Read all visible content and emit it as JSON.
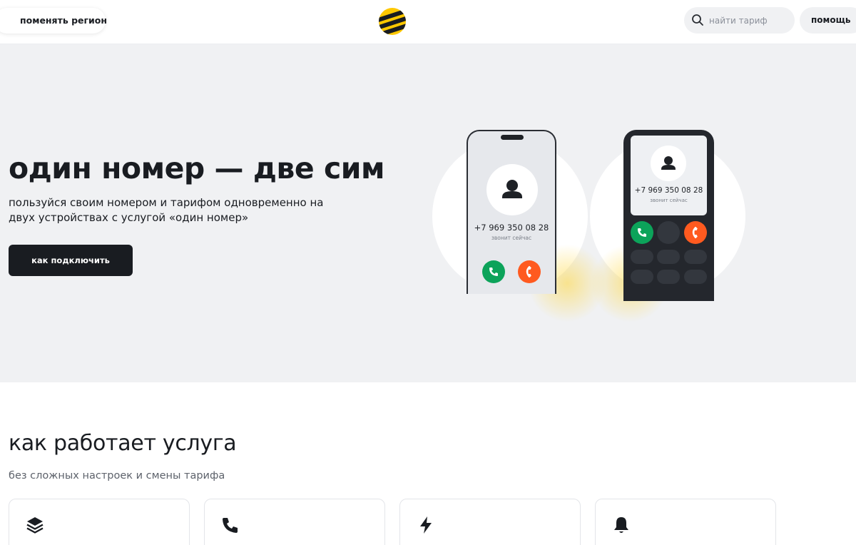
{
  "header": {
    "region_label": "поменять регион",
    "search_placeholder": "найти тариф",
    "help_label": "помощь"
  },
  "hero": {
    "title": "один номер — две сим",
    "subtitle": "пользуйся своим номером и тарифом одновременно на двух устройствах с услугой «один номер»",
    "button_label": "как подключить",
    "phone_a": {
      "number": "+7 969 350 08 28",
      "status": "звонит сейчас"
    },
    "phone_b": {
      "number": "+7 969 350 08 28",
      "status": "звонит сейчас"
    }
  },
  "section": {
    "title": "как работает услуга",
    "subtitle": "без сложных настроек и смены тарифа",
    "cards": [
      {
        "icon": "layers-icon"
      },
      {
        "icon": "phone-icon"
      },
      {
        "icon": "lightning-icon"
      },
      {
        "icon": "bell-icon"
      }
    ]
  },
  "colors": {
    "brand_yellow": "#ffc800",
    "dark": "#191c21",
    "hero_bg": "#f0f1f3",
    "accept_green": "#0ca35a",
    "decline_orange": "#ff5a1f"
  }
}
